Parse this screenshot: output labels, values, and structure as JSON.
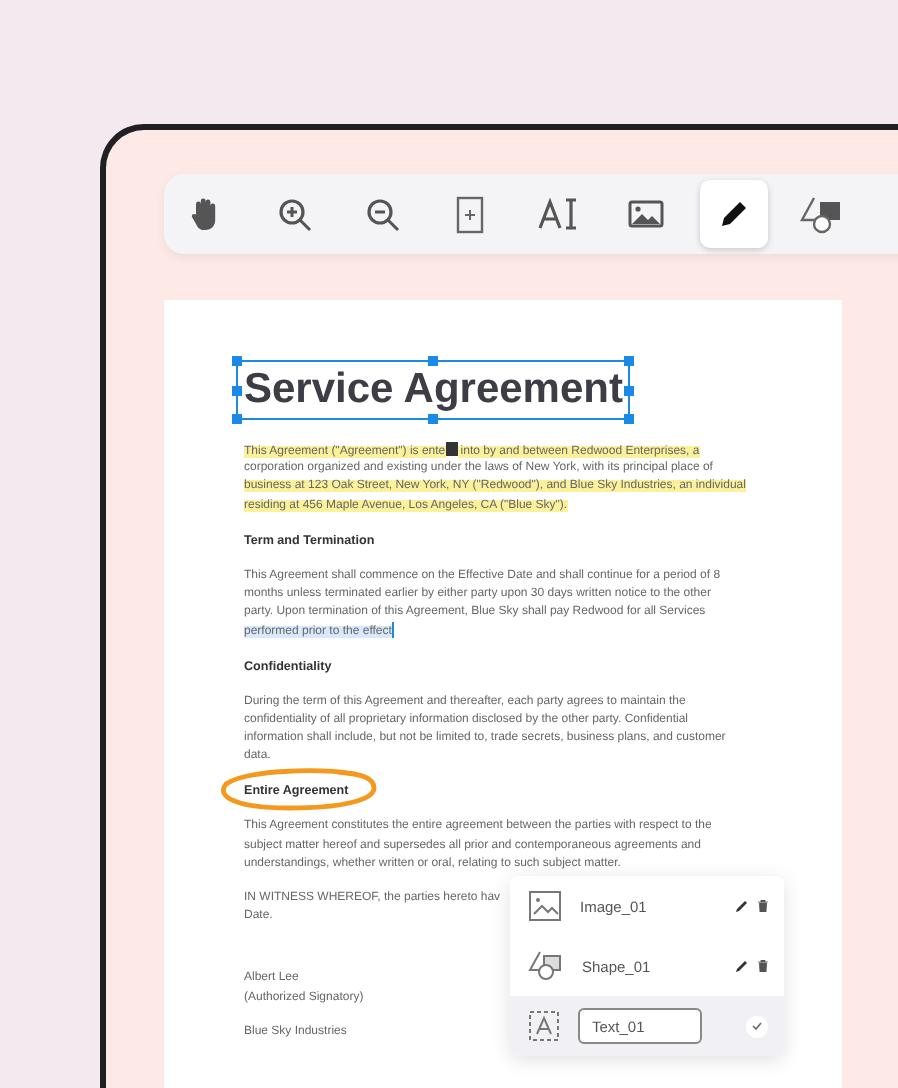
{
  "toolbar": {
    "tools": [
      {
        "kind": "hand",
        "selected": false
      },
      {
        "kind": "zoom-in",
        "selected": false
      },
      {
        "kind": "zoom-out",
        "selected": false
      },
      {
        "kind": "fit",
        "selected": false
      },
      {
        "kind": "text",
        "selected": false
      },
      {
        "kind": "image",
        "selected": false
      },
      {
        "kind": "pen",
        "selected": true
      },
      {
        "kind": "shape",
        "selected": false
      }
    ]
  },
  "document": {
    "title": "Service Agreement",
    "title_selected": true,
    "blocks": [
      {
        "kind": "rich_paragraph",
        "lines": [
          [
            {
              "kind": "text",
              "marked": true,
              "selected": false,
              "text": "This Agreement (\"Agreement\") is ente"
            },
            {
              "kind": "cursor"
            },
            {
              "kind": "text",
              "marked": true,
              "selected": false,
              "text": " into by and between Redwood Enterprises, a"
            }
          ],
          [
            {
              "kind": "text",
              "marked": false,
              "selected": false,
              "text": "corporation organized and existing under the laws of New York, with its principal place of"
            }
          ],
          [
            {
              "kind": "text",
              "marked": true,
              "selected": false,
              "text": "business at 123 Oak Street, New York, NY (\"Redwood\"), and Blue Sky Industries, an individual"
            }
          ],
          [
            {
              "kind": "text",
              "marked": true,
              "selected": false,
              "text": "residing at 456 Maple Avenue, Los Angeles, CA (\"Blue Sky\")."
            }
          ]
        ]
      },
      {
        "kind": "heading",
        "text": "Term and Termination",
        "circled": false
      },
      {
        "kind": "rich_paragraph",
        "lines": [
          [
            {
              "kind": "text",
              "marked": false,
              "selected": false,
              "text": "This Agreement shall commence on the Effective Date and shall continue for a period of 8"
            }
          ],
          [
            {
              "kind": "text",
              "marked": false,
              "selected": false,
              "text": "months unless terminated earlier by either party upon 30 days written notice to the other"
            }
          ],
          [
            {
              "kind": "text",
              "marked": false,
              "selected": false,
              "text": "party. Upon termination of this Agreement, Blue Sky shall pay Redwood for all Services"
            }
          ],
          [
            {
              "kind": "text",
              "marked": false,
              "selected": true,
              "text": "performed prior to the effect"
            },
            {
              "kind": "caret"
            }
          ]
        ]
      },
      {
        "kind": "heading",
        "text": "Confidentiality",
        "circled": false
      },
      {
        "kind": "paragraph",
        "text": "During the term of this Agreement and thereafter, each party agrees to maintain the\nconfidentiality of all proprietary information disclosed by the other party. Confidential\ninformation shall include, but not be limited to, trade secrets, business plans, and customer\ndata."
      },
      {
        "kind": "heading",
        "text": "Entire Agreement",
        "circled": true
      },
      {
        "kind": "paragraph",
        "text": "This Agreement constitutes the entire agreement between the parties with respect to the\nsubject matter hereof and supersedes all prior and contemporaneous agreements and\nunderstandings, whether written or oral, relating to such subject matter."
      },
      {
        "kind": "paragraph",
        "text": "IN WITNESS WHEREOF, the parties hereto hav\nDate."
      },
      {
        "kind": "signature",
        "text": "Albert Lee\n(Authorized Signatory)"
      },
      {
        "kind": "paragraph",
        "text": "Blue Sky Industries"
      }
    ]
  },
  "layers": [
    {
      "kind": "image",
      "name": "Image_01",
      "editing": false
    },
    {
      "kind": "shape",
      "name": "Shape_01",
      "editing": false
    },
    {
      "kind": "text",
      "name": "Text_01",
      "editing": true
    }
  ]
}
